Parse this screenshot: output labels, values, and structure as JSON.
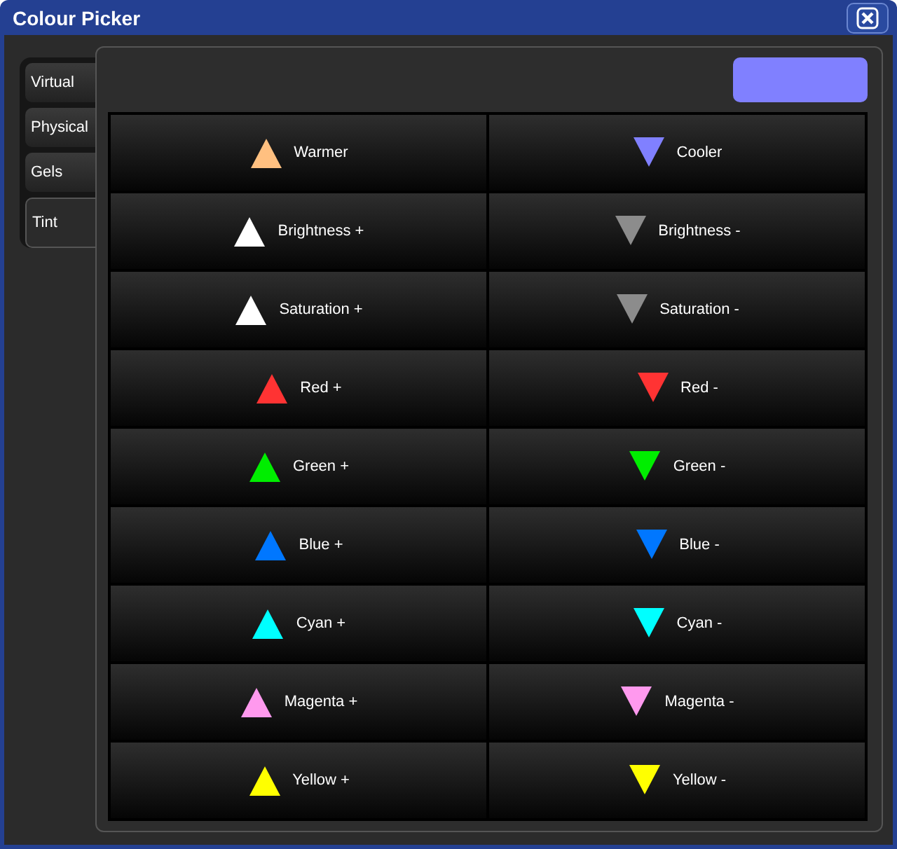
{
  "window": {
    "title": "Colour Picker"
  },
  "tabs": [
    {
      "label": "Virtual",
      "selected": false
    },
    {
      "label": "Physical",
      "selected": false
    },
    {
      "label": "Gels",
      "selected": false
    },
    {
      "label": "Tint",
      "selected": true
    }
  ],
  "swatch": {
    "color": "#8080ff"
  },
  "buttons": [
    {
      "label": "Warmer",
      "kind": "up",
      "color": "#ffc080"
    },
    {
      "label": "Cooler",
      "kind": "down",
      "color": "#8080ff"
    },
    {
      "label": "Brightness +",
      "kind": "up",
      "color": "#ffffff"
    },
    {
      "label": "Brightness -",
      "kind": "down",
      "color": "#8c8c8c"
    },
    {
      "label": "Saturation +",
      "kind": "up",
      "color": "#ffffff"
    },
    {
      "label": "Saturation -",
      "kind": "down",
      "color": "#8c8c8c"
    },
    {
      "label": "Red +",
      "kind": "up",
      "color": "#ff3333"
    },
    {
      "label": "Red -",
      "kind": "down",
      "color": "#ff3333"
    },
    {
      "label": "Green +",
      "kind": "up",
      "color": "#00ee00"
    },
    {
      "label": "Green -",
      "kind": "down",
      "color": "#00ee00"
    },
    {
      "label": "Blue +",
      "kind": "up",
      "color": "#0077ff"
    },
    {
      "label": "Blue -",
      "kind": "down",
      "color": "#0077ff"
    },
    {
      "label": "Cyan +",
      "kind": "up",
      "color": "#00ffff"
    },
    {
      "label": "Cyan -",
      "kind": "down",
      "color": "#00ffff"
    },
    {
      "label": "Magenta +",
      "kind": "up",
      "color": "#ff99ee"
    },
    {
      "label": "Magenta -",
      "kind": "down",
      "color": "#ff99ee"
    },
    {
      "label": "Yellow +",
      "kind": "up",
      "color": "#ffff00"
    },
    {
      "label": "Yellow -",
      "kind": "down",
      "color": "#ffff00"
    }
  ]
}
